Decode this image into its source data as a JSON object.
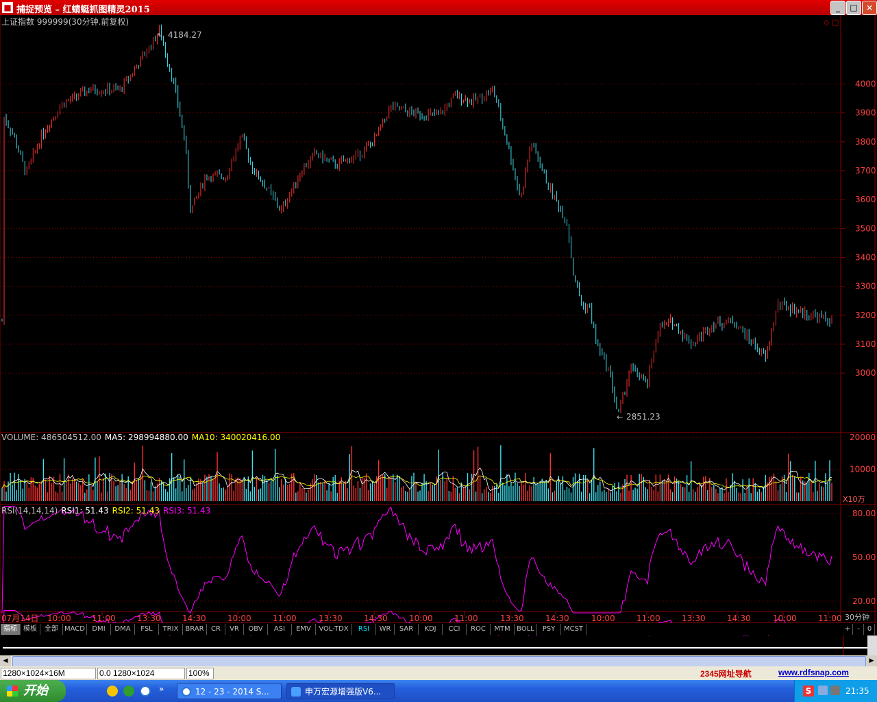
{
  "window": {
    "title": "捕捉预览  –  红蜻蜓抓图精灵2015",
    "controls": {
      "minimize": "_",
      "maximize": "□",
      "close": "×"
    }
  },
  "chart": {
    "header": "上证指数 999999(30分钟.前复权)",
    "price_ticks": [
      "4000",
      "3900",
      "3800",
      "3700",
      "3600",
      "3500",
      "3400",
      "3300",
      "3200",
      "3100",
      "3000"
    ],
    "high_label": "4184.27",
    "low_label": "2851.23",
    "volume_header": {
      "title": "VOLUME: 486504512.00",
      "ma5": "MA5: 298994880.00",
      "ma10": "MA10: 340020416.00"
    },
    "volume_ticks": [
      "20000",
      "10000"
    ],
    "volume_unit": "X10万",
    "rsi_header": {
      "title": "RSI(14,14,14)",
      "rsi1": "RSI1: 51.43",
      "rsi2": "RSI2: 51.43",
      "rsi3": "RSI3: 51.43"
    },
    "rsi_ticks": [
      "80.00",
      "50.00",
      "20.00"
    ],
    "time_labels": [
      "07月14日",
      "10:00",
      "11:00",
      "13:30",
      "14:30",
      "10:00",
      "11:00",
      "13:30",
      "14:30",
      "10:00",
      "11:00",
      "13:30",
      "14:30",
      "10:00",
      "11:00",
      "13:30",
      "14:30",
      "10:00",
      "11:00",
      "13:30",
      "14:30",
      "10:00",
      "11:00"
    ],
    "period": "30分钟",
    "colors": {
      "up": "#ff3030",
      "down": "#40e0f0",
      "grid": "#8b0000",
      "ma5": "#ffffff",
      "ma10": "#ffff00",
      "rsi": "#ff00ff"
    }
  },
  "tabs": [
    "指标",
    "模板",
    "全部",
    "MACD",
    "DMI",
    "DMA",
    "FSL",
    "TRIX",
    "BRAR",
    "CR",
    "VR",
    "OBV",
    "ASI",
    "EMV",
    "VOL-TDX",
    "RSI",
    "WR",
    "SAR",
    "KDJ",
    "CCI",
    "ROC",
    "MTM",
    "BOLL",
    "PSY",
    "MCST"
  ],
  "selected_tab": "RSI",
  "tab_controls": [
    "+",
    "-",
    "0"
  ],
  "statusbar": {
    "size": "1280×1024×16M",
    "coords": "0.0  1280×1024",
    "zoom": "100%",
    "ad": "2345网址导航",
    "site": "www.rdfsnap.com"
  },
  "taskbar": {
    "start": "开始",
    "tasks": [
      "12 - 23 - 2014 S...",
      "申万宏源增强版V6..."
    ],
    "clock": "21:35"
  }
}
